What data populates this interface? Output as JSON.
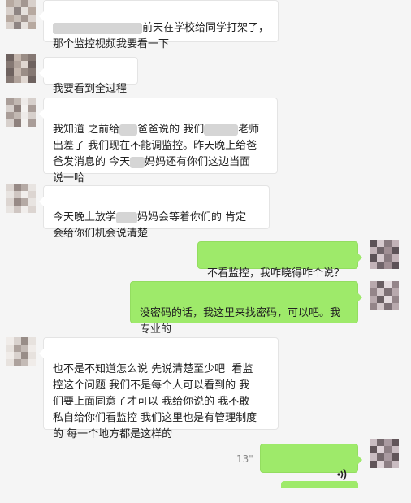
{
  "messages": [
    {
      "from": "them",
      "text_a": "",
      "text_b": "前天在学校给同学打架了，",
      "text_c": "那个监控视频我要看一下"
    },
    {
      "from": "them",
      "text_a": "我要看到全过程"
    },
    {
      "from": "them",
      "text_a": "我知道 之前给",
      "text_b": "爸爸说的 我们",
      "text_c": "老师",
      "text_d": "出差了 我们现在不能调监控。昨天晚上给爸",
      "text_e": "爸发消息的 今天",
      "text_f": "妈妈还有你们这边当面",
      "text_g": "说一哈"
    },
    {
      "from": "them",
      "text_a": "今天晚上放学",
      "text_b": "妈妈会等着你们的 肯定",
      "text_c": "会给你们机会说清楚"
    },
    {
      "from": "me",
      "text_a": "不看监控，我咋晓得咋个说？"
    },
    {
      "from": "me",
      "text_a": "没密码的话，我这里来找密码，可以吧。我",
      "text_b": "专业的"
    },
    {
      "from": "them",
      "text_a": "也不是不知道怎么说 先说清楚至少吧  看监",
      "text_b": "控这个问题 我们不是每个人可以看到的 我",
      "text_c": "们要上面同意了才可以 我给你说的 我不敢",
      "text_d": "私自给你们看监控 我们这里也是有管理制度",
      "text_e": "的 每一个地方都是这样的"
    },
    {
      "from": "me",
      "type": "voice",
      "duration": "13\""
    }
  ],
  "colors": {
    "out_bubble": "#9eea6a",
    "in_bubble": "#ffffff",
    "background": "#f5f5f5"
  },
  "icons": {
    "voice": "voice-wave-icon"
  }
}
